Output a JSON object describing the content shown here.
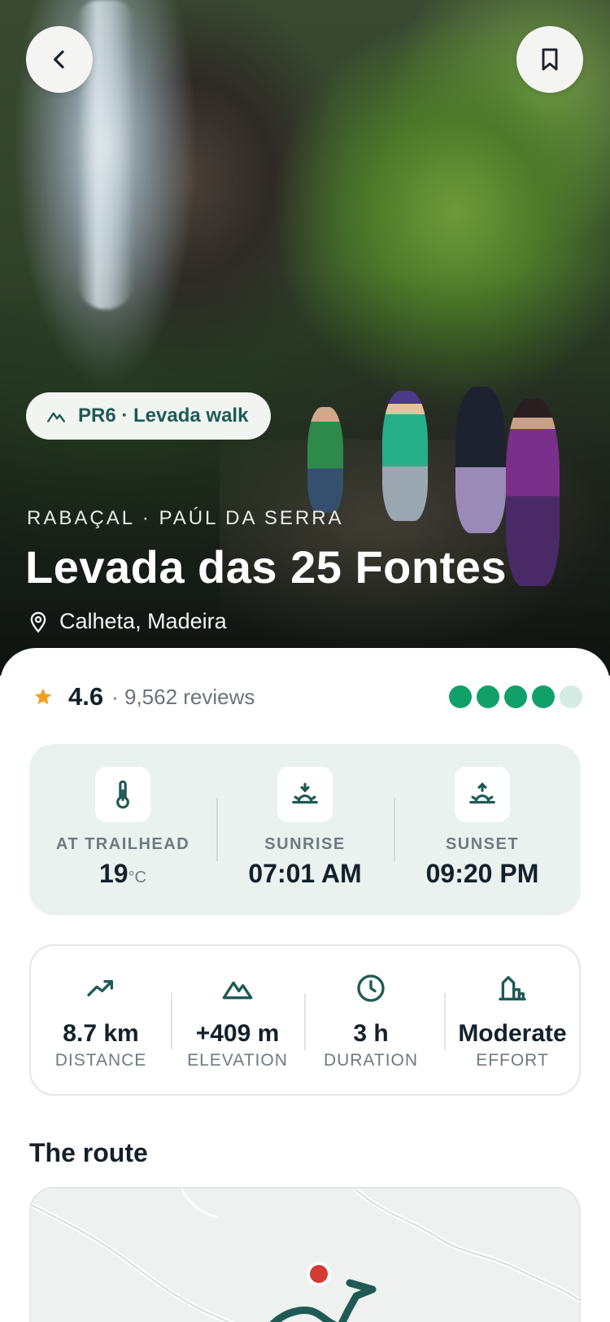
{
  "hero": {
    "tag": "PR6 · Levada walk",
    "region": "RABAÇAL · PAÚL DA SERRA",
    "title": "Levada das 25 Fontes",
    "location": "Calheta, Madeira"
  },
  "icons": {
    "back": "chevron-left-icon",
    "bookmark": "bookmark-icon",
    "tag": "mountain-icon",
    "location": "map-pin-icon",
    "star": "star-icon"
  },
  "rating": {
    "value": "4.6",
    "reviews": "· 9,562 reviews",
    "score_dots": 4,
    "max_dots": 5
  },
  "conditions": [
    {
      "label": "AT TRAILHEAD",
      "value": "19",
      "unit": "°C",
      "icon": "thermometer-icon"
    },
    {
      "label": "SUNRISE",
      "value": "07:01 AM",
      "icon": "sunrise-icon"
    },
    {
      "label": "SUNSET",
      "value": "09:20 PM",
      "icon": "sunset-icon"
    }
  ],
  "stats": [
    {
      "value": "8.7 km",
      "label": "DISTANCE",
      "icon": "trend-icon"
    },
    {
      "value": "+409 m",
      "label": "ELEVATION",
      "icon": "mountain-icon"
    },
    {
      "value": "3 h",
      "label": "DURATION",
      "icon": "clock-icon"
    },
    {
      "value": "Moderate",
      "label": "EFFORT",
      "icon": "effort-icon"
    }
  ],
  "route": {
    "title": "The route"
  },
  "colors": {
    "accent": "#1f5a55",
    "rating_dot": "#12a06a",
    "rating_dot_empty": "#d4ece4",
    "star": "#f0a020",
    "route_start": "#d23a36"
  }
}
